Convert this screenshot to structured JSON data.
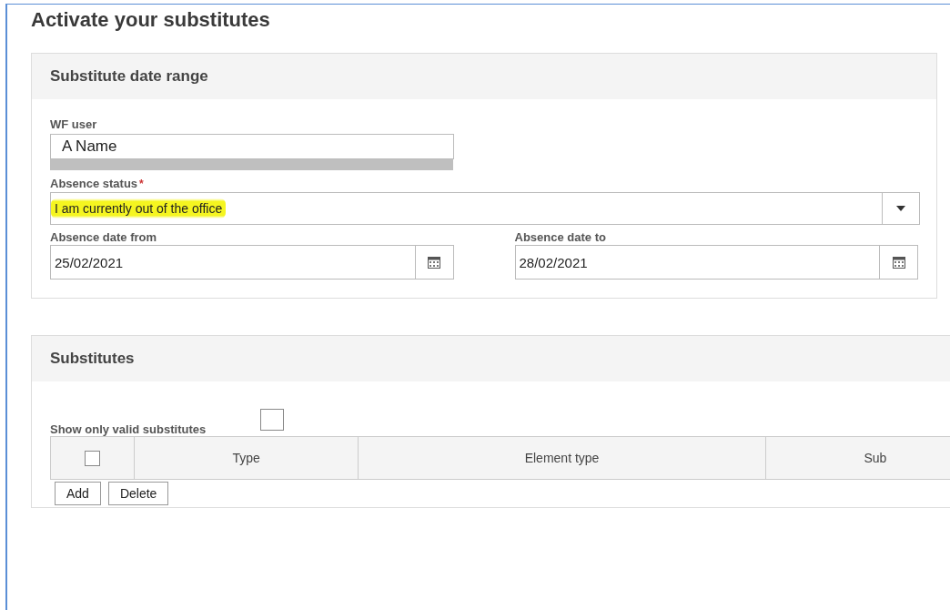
{
  "page_title": "Activate your substitutes",
  "date_range": {
    "title": "Substitute date range",
    "wf_user": {
      "label": "WF user",
      "value": "A Name",
      "redacted": true
    },
    "absence_status": {
      "label": "Absence status",
      "required_mark": "*",
      "value": "I am currently out of the office",
      "highlighted": true
    },
    "date_from": {
      "label": "Absence date from",
      "value": "25/02/2021"
    },
    "date_to": {
      "label": "Absence date to",
      "value": "28/02/2021"
    }
  },
  "substitutes": {
    "title": "Substitutes",
    "valid_only": {
      "label": "Show only valid substitutes",
      "checked": false
    },
    "table": {
      "select_all": false,
      "columns": [
        "Type",
        "Element type",
        "Sub"
      ]
    },
    "buttons": [
      "Add",
      "Delete"
    ]
  }
}
